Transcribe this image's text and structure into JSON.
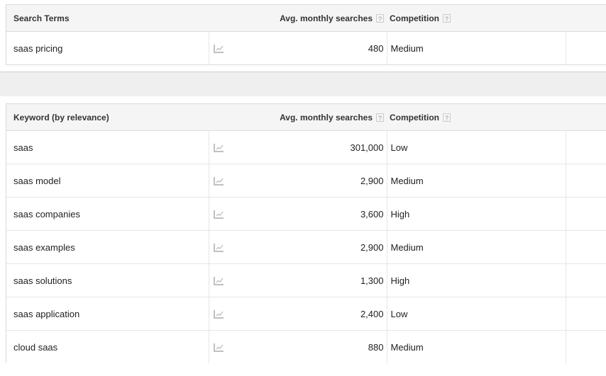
{
  "search_terms_table": {
    "columns": [
      {
        "key": "keyword",
        "label": "Search Terms"
      },
      {
        "key": "spark",
        "label": ""
      },
      {
        "key": "volume",
        "label": "Avg. monthly searches",
        "help": "?"
      },
      {
        "key": "competition",
        "label": "Competition",
        "help": "?"
      },
      {
        "key": "extra",
        "label": ""
      }
    ],
    "rows": [
      {
        "keyword": "saas pricing",
        "spark_icon": "trend-chart-icon",
        "volume": "480",
        "competition": "Medium",
        "extra": ""
      }
    ]
  },
  "keyword_ideas_table": {
    "columns": [
      {
        "key": "keyword",
        "label": "Keyword (by relevance)"
      },
      {
        "key": "spark",
        "label": ""
      },
      {
        "key": "volume",
        "label": "Avg. monthly searches",
        "help": "?"
      },
      {
        "key": "competition",
        "label": "Competition",
        "help": "?"
      },
      {
        "key": "extra",
        "label": ""
      }
    ],
    "rows": [
      {
        "keyword": "saas",
        "spark_icon": "trend-chart-icon",
        "volume": "301,000",
        "competition": "Low",
        "extra": ""
      },
      {
        "keyword": "saas model",
        "spark_icon": "trend-chart-icon",
        "volume": "2,900",
        "competition": "Medium",
        "extra": ""
      },
      {
        "keyword": "saas companies",
        "spark_icon": "trend-chart-icon",
        "volume": "3,600",
        "competition": "High",
        "extra": ""
      },
      {
        "keyword": "saas examples",
        "spark_icon": "trend-chart-icon",
        "volume": "2,900",
        "competition": "Medium",
        "extra": ""
      },
      {
        "keyword": "saas solutions",
        "spark_icon": "trend-chart-icon",
        "volume": "1,300",
        "competition": "High",
        "extra": ""
      },
      {
        "keyword": "saas application",
        "spark_icon": "trend-chart-icon",
        "volume": "2,400",
        "competition": "Low",
        "extra": ""
      },
      {
        "keyword": "cloud saas",
        "spark_icon": "trend-chart-icon",
        "volume": "880",
        "competition": "Medium",
        "extra": ""
      }
    ]
  },
  "colors": {
    "header_bg": "#f5f5f5",
    "panel_border": "#d9d9d9",
    "row_border": "#e6e6e6",
    "gap_band_bg": "#efefef",
    "text": "#222222",
    "help_icon": "#9a9a9a"
  }
}
